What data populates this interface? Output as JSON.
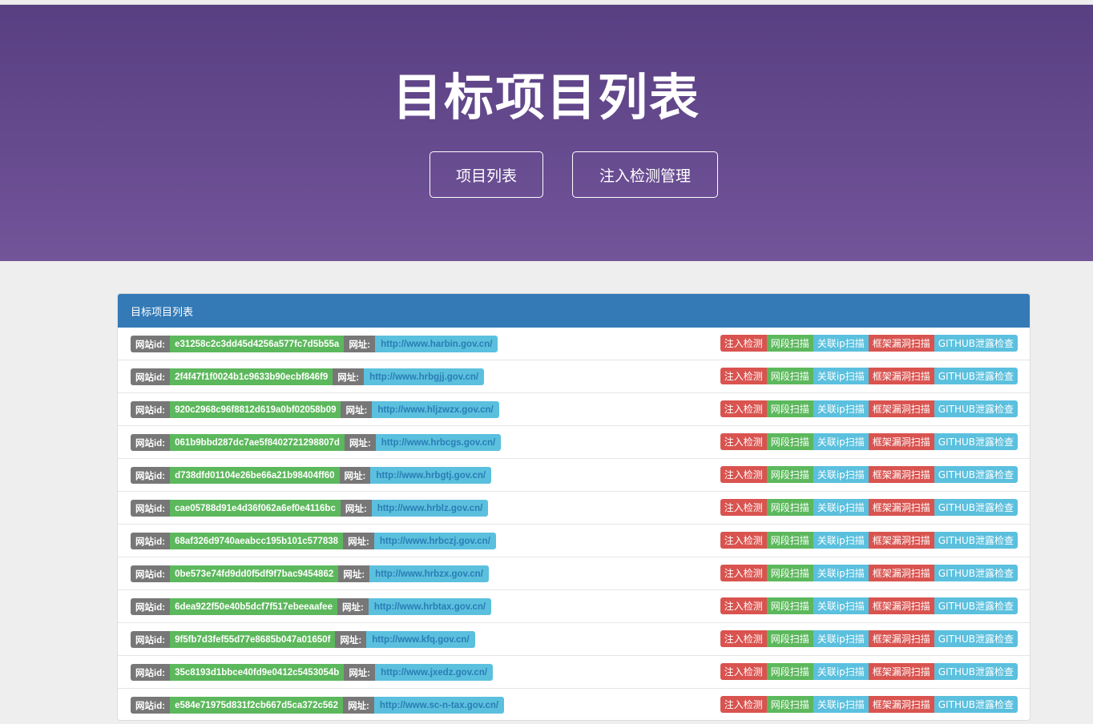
{
  "hero": {
    "title": "目标项目列表",
    "nav": [
      "项目列表",
      "注入检测管理"
    ]
  },
  "panel": {
    "heading": "目标项目列表",
    "id_label": "网站id:",
    "url_label": "网址:",
    "actions": [
      "注入检测",
      "网段扫描",
      "关联ip扫描",
      "框架漏洞扫描",
      "GITHUB泄露检查"
    ],
    "rows": [
      {
        "id": "e31258c2c3dd45d4256a577fc7d5b55a",
        "url": "http://www.harbin.gov.cn/"
      },
      {
        "id": "2f4f47f1f0024b1c9633b90ecbf846f9",
        "url": "http://www.hrbgjj.gov.cn/"
      },
      {
        "id": "920c2968c96f8812d619a0bf02058b09",
        "url": "http://www.hljzwzx.gov.cn/"
      },
      {
        "id": "061b9bbd287dc7ae5f8402721298807d",
        "url": "http://www.hrbcgs.gov.cn/"
      },
      {
        "id": "d738dfd01104e26be66a21b98404ff60",
        "url": "http://www.hrbgtj.gov.cn/"
      },
      {
        "id": "cae05788d91e4d36f062a6ef0e4116bc",
        "url": "http://www.hrblz.gov.cn/"
      },
      {
        "id": "68af326d9740aeabcc195b101c577838",
        "url": "http://www.hrbczj.gov.cn/"
      },
      {
        "id": "0be573e74fd9dd0f5df9f7bac9454862",
        "url": "http://www.hrbzx.gov.cn/"
      },
      {
        "id": "6dea922f50e40b5dcf7f517ebeeaafee",
        "url": "http://www.hrbtax.gov.cn/"
      },
      {
        "id": "9f5fb7d3fef55d77e8685b047a01650f",
        "url": "http://www.kfq.gov.cn/"
      },
      {
        "id": "35c8193d1bbce40fd9e0412c5453054b",
        "url": "http://www.jxedz.gov.cn/"
      },
      {
        "id": "e584e71975d831f2cb667d5ca372c562",
        "url": "http://www.sc-n-tax.gov.cn/"
      }
    ]
  }
}
